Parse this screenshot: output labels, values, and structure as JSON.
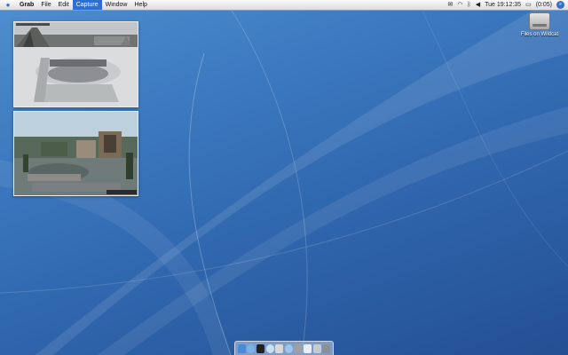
{
  "menubar": {
    "apple": "",
    "app_name": "Grab",
    "menus": [
      "File",
      "Edit",
      "Capture",
      "Window",
      "Help"
    ],
    "active_menu": "Capture",
    "clock": "Tue 19:12:35",
    "battery": "(0:05)"
  },
  "desktop": {
    "disk_label": "Files on Wildcat"
  },
  "thumbnails": {
    "cam1_caption": "",
    "cam2_caption": ""
  },
  "dock": {
    "icons": [
      "finder-icon",
      "safari-icon",
      "mail-icon",
      "terminal-icon",
      "itunes-icon",
      "ichat-icon",
      "preferences-icon",
      "grab-icon",
      "preview-icon",
      "trash-icon"
    ]
  }
}
